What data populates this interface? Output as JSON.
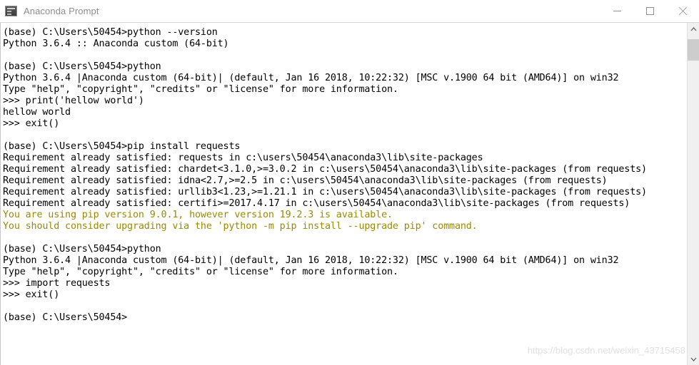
{
  "window": {
    "title": "Anaconda Prompt",
    "icon": "console-icon",
    "controls": {
      "minimize": "minimize-button",
      "maximize": "maximize-button",
      "close": "close-button"
    }
  },
  "colors": {
    "background": "#ffffff",
    "text": "#000000",
    "warning": "#9a8a00",
    "title_text": "#8d8d8d",
    "watermark": "#e0e0e0",
    "scrollbar_track": "#f0f0f0",
    "scrollbar_thumb": "#cdcdcd"
  },
  "console": {
    "lines": [
      {
        "text": "(base) C:\\Users\\50454>python --version",
        "style": "normal"
      },
      {
        "text": "Python 3.6.4 :: Anaconda custom (64-bit)",
        "style": "normal"
      },
      {
        "text": "",
        "style": "blank"
      },
      {
        "text": "(base) C:\\Users\\50454>python",
        "style": "normal"
      },
      {
        "text": "Python 3.6.4 |Anaconda custom (64-bit)| (default, Jan 16 2018, 10:22:32) [MSC v.1900 64 bit (AMD64)] on win32",
        "style": "normal"
      },
      {
        "text": "Type \"help\", \"copyright\", \"credits\" or \"license\" for more information.",
        "style": "normal"
      },
      {
        "text": ">>> print('hellow world')",
        "style": "normal"
      },
      {
        "text": "hellow world",
        "style": "normal"
      },
      {
        "text": ">>> exit()",
        "style": "normal"
      },
      {
        "text": "",
        "style": "blank"
      },
      {
        "text": "(base) C:\\Users\\50454>pip install requests",
        "style": "normal"
      },
      {
        "text": "Requirement already satisfied: requests in c:\\users\\50454\\anaconda3\\lib\\site-packages",
        "style": "normal"
      },
      {
        "text": "Requirement already satisfied: chardet<3.1.0,>=3.0.2 in c:\\users\\50454\\anaconda3\\lib\\site-packages (from requests)",
        "style": "normal"
      },
      {
        "text": "Requirement already satisfied: idna<2.7,>=2.5 in c:\\users\\50454\\anaconda3\\lib\\site-packages (from requests)",
        "style": "normal"
      },
      {
        "text": "Requirement already satisfied: urllib3<1.23,>=1.21.1 in c:\\users\\50454\\anaconda3\\lib\\site-packages (from requests)",
        "style": "normal"
      },
      {
        "text": "Requirement already satisfied: certifi>=2017.4.17 in c:\\users\\50454\\anaconda3\\lib\\site-packages (from requests)",
        "style": "normal"
      },
      {
        "text": "You are using pip version 9.0.1, however version 19.2.3 is available.",
        "style": "warn"
      },
      {
        "text": "You should consider upgrading via the 'python -m pip install --upgrade pip' command.",
        "style": "warn"
      },
      {
        "text": "",
        "style": "blank"
      },
      {
        "text": "(base) C:\\Users\\50454>python",
        "style": "normal"
      },
      {
        "text": "Python 3.6.4 |Anaconda custom (64-bit)| (default, Jan 16 2018, 10:22:32) [MSC v.1900 64 bit (AMD64)] on win32",
        "style": "normal"
      },
      {
        "text": "Type \"help\", \"copyright\", \"credits\" or \"license\" for more information.",
        "style": "normal"
      },
      {
        "text": ">>> import requests",
        "style": "normal"
      },
      {
        "text": ">>> exit()",
        "style": "normal"
      },
      {
        "text": "",
        "style": "blank"
      },
      {
        "text": "(base) C:\\Users\\50454>",
        "style": "normal"
      }
    ]
  },
  "scrollbar": {
    "up_arrow": "scroll-up-arrow",
    "down_arrow": "scroll-down-arrow",
    "thumb": "scrollbar-thumb"
  },
  "watermark": {
    "text": "https://blog.csdn.net/weixin_43715458"
  }
}
